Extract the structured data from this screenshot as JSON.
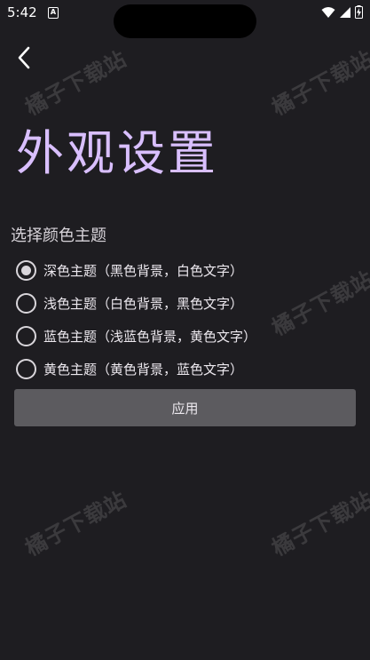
{
  "status_bar": {
    "time": "5:42",
    "notification_icon": "A"
  },
  "header": {
    "back_icon": "chevron-left-icon"
  },
  "page_title": "外观设置",
  "section_label": "选择颜色主题",
  "theme_options": [
    {
      "label": "深色主题（黑色背景，白色文字）",
      "selected": true
    },
    {
      "label": "浅色主题（白色背景，黑色文字）",
      "selected": false
    },
    {
      "label": "蓝色主题（浅蓝色背景，黄色文字）",
      "selected": false
    },
    {
      "label": "黄色主题（黄色背景，蓝色文字）",
      "selected": false
    }
  ],
  "apply_label": "应用",
  "watermark_text": "橘子下载站",
  "colors": {
    "background": "#1e1d21",
    "title": "#d9bfff",
    "button": "#5c5b5f"
  }
}
